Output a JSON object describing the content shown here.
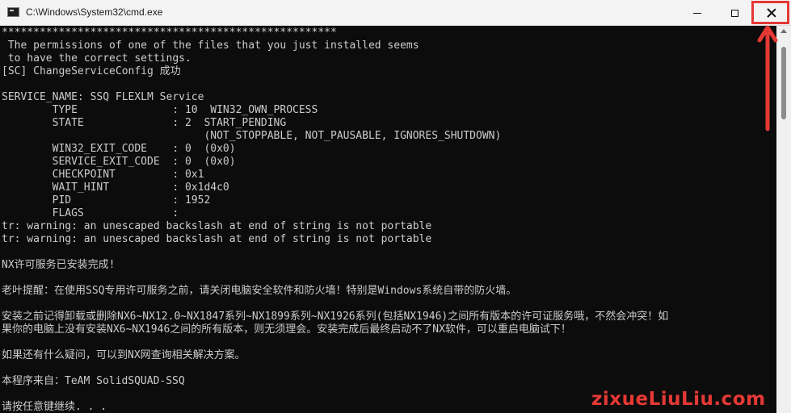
{
  "window": {
    "title": "C:\\Windows\\System32\\cmd.exe",
    "controls": {
      "minimize_icon": "minimize-icon",
      "maximize_icon": "maximize-icon",
      "close_icon": "close-icon"
    }
  },
  "console": {
    "colors": {
      "background": "#0c0c0c",
      "text": "#cccccc"
    },
    "lines": [
      "*****************************************************",
      " The permissions of one of the files that you just installed seems",
      " to have the correct settings.",
      "[SC] ChangeServiceConfig 成功",
      "",
      "SERVICE_NAME: SSQ FLEXLM Service",
      "        TYPE               : 10  WIN32_OWN_PROCESS",
      "        STATE              : 2  START_PENDING",
      "                                (NOT_STOPPABLE, NOT_PAUSABLE, IGNORES_SHUTDOWN)",
      "        WIN32_EXIT_CODE    : 0  (0x0)",
      "        SERVICE_EXIT_CODE  : 0  (0x0)",
      "        CHECKPOINT         : 0x1",
      "        WAIT_HINT          : 0x1d4c0",
      "        PID                : 1952",
      "        FLAGS              :",
      "tr: warning: an unescaped backslash at end of string is not portable",
      "tr: warning: an unescaped backslash at end of string is not portable",
      "",
      "NX许可服务已安装完成!",
      "",
      "老叶提醒：在使用SSQ专用许可服务之前，请关闭电脑安全软件和防火墙！特别是Windows系统自带的防火墙。",
      "",
      "安装之前记得卸载或删除NX6~NX12.0~NX1847系列~NX1899系列~NX1926系列(包括NX1946)之间所有版本的许可证服务哦，不然会冲突！如",
      "果你的电脑上没有安装NX6~NX1946之间的所有版本，则无须理会。安装完成后最终启动不了NX软件，可以重启电脑试下！",
      "",
      "如果还有什么疑问，可以到NX网查询相关解决方案。",
      "",
      "本程序来自：TeAM SolidSQUAD-SSQ",
      "",
      "请按任意键继续. . ."
    ]
  },
  "annotation": {
    "color": "#e53935"
  },
  "watermark": {
    "brand": "zixueLiuLiu.com",
    "color": "#e53935"
  }
}
